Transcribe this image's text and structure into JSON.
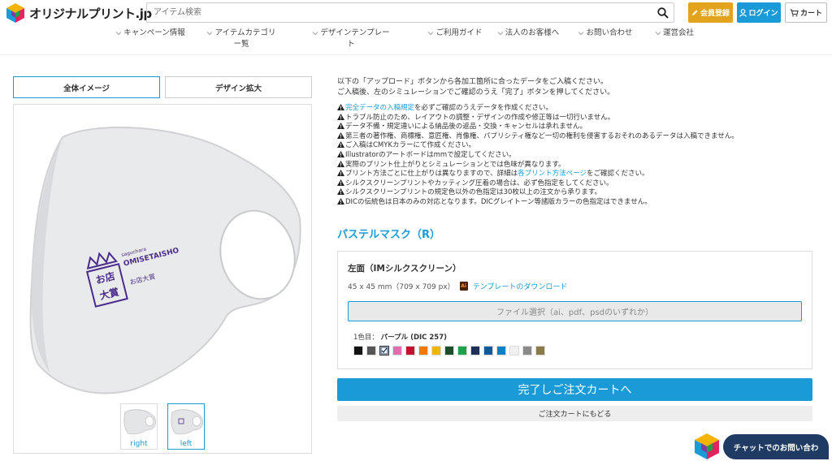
{
  "brand": {
    "name": "オリジナルプリント.jp"
  },
  "search": {
    "placeholder": "アイテム検索"
  },
  "header_buttons": {
    "member": "会員登録",
    "login": "ログイン",
    "cart": "カート"
  },
  "nav": [
    {
      "label": "キャンペーン情報"
    },
    {
      "label": "アイテムカテゴリー覧"
    },
    {
      "label": "デザインテンプレート"
    },
    {
      "label": "ご利用ガイド"
    },
    {
      "label": "法人のお客様へ"
    },
    {
      "label": "お問い合わせ"
    },
    {
      "label": "運営会社"
    }
  ],
  "view_tabs": {
    "whole": "全体イメージ",
    "zoom": "デザイン拡大"
  },
  "thumbnails": {
    "right": "right",
    "left": "left"
  },
  "print_logo": {
    "top": "saguchara",
    "brand": "OMISETAISHO",
    "sub": "お店大賞"
  },
  "intro": {
    "line1": "以下の「アップロード」ボタンから各加工箇所に合ったデータをご入稿ください。",
    "line2": "ご入稿後、左のシミュレーションでご確認のうえ「完了」ボタンを押してください。"
  },
  "notes": [
    {
      "link": "完全データの入稿規定",
      "text": "を必ずご確認のうえデータを作成ください。"
    },
    {
      "text": "トラブル防止のため、レイアウトの調整・デザインの作成や修正等は一切行いません。"
    },
    {
      "text": "データ不備・規定違いによる納品後の返品・交換・キャンセルは承れません。"
    },
    {
      "text": "第三者の著作権、商標権、意匠権、肖像権、パブリシティ権など一切の権利を侵害するおそれのあるデータは入稿できません。"
    },
    {
      "text": "ご入稿はCMYKカラーにて作成ください。"
    },
    {
      "text": "Illustratorのアートボードはmmで設定してください。"
    },
    {
      "text": "実際のプリント仕上がりとシミュレーションとでは色味が異なります。"
    },
    {
      "pre": "プリント方法ごとに仕上がりは異なりますので、詳細は",
      "link": "各プリント方法ページ",
      "text": "をご確認ください。"
    },
    {
      "text": "シルクスクリーンプリントやカッティング圧着の場合は、必ず色指定をしてください。"
    },
    {
      "text": "シルクスクリーンプリントの規定色以外の色指定は30枚以上の注文から承ります。"
    },
    {
      "text": "DICの伝統色は日本のみの対応となります。DICグレイトーン等諸版カラーの色指定はできません。"
    }
  ],
  "product": {
    "title": "パステルマスク（R）"
  },
  "spec": {
    "side_title": "左面（IMシルクスクリーン）",
    "size": "45 x 45 mm（709 x 709 px）",
    "ai_icon": "Ai",
    "template_link": "テンプレートのダウンロード",
    "file_select": "ファイル選択（ai、pdf、psdのいずれか）",
    "color_label": "1色目：",
    "color_value": "パープル (DIC 257)"
  },
  "swatches": [
    "#111111",
    "#555555",
    "#ffffff",
    "#e06fb0",
    "#c4122f",
    "#f07a00",
    "#f4b400",
    "#1d4d2b",
    "#1aa34a",
    "#1f2f5c",
    "#0a5aa0",
    "#0b7fc4",
    "#f0f0f0",
    "#8a8a8a",
    "#8b7a4a"
  ],
  "selected_swatch": 2,
  "actions": {
    "complete": "完了しご注文カートへ",
    "back": "ご注文カートにもどる"
  },
  "chat": {
    "label": "チャットでのお問い合わ"
  }
}
